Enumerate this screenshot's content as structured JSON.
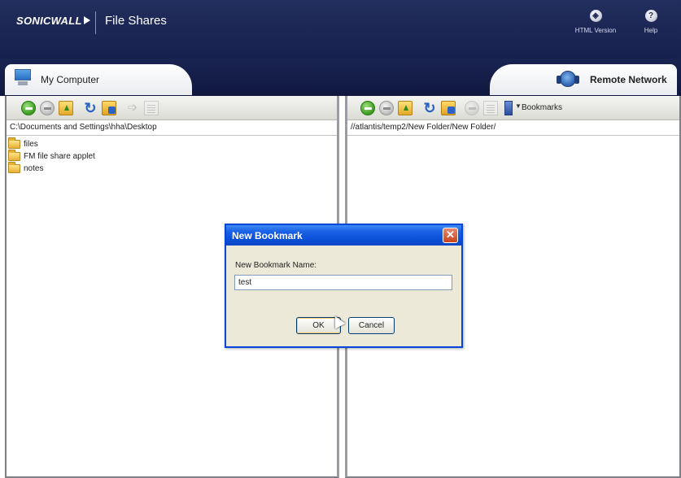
{
  "header": {
    "brand": "SONICWALL",
    "app_title": "File Shares",
    "html_version_label": "HTML Version",
    "help_label": "Help"
  },
  "tabs": {
    "left_label": "My Computer",
    "right_label": "Remote Network"
  },
  "left_panel": {
    "path": "C:\\Documents and Settings\\hha\\Desktop",
    "items": [
      "files",
      "FM file share applet",
      "notes"
    ]
  },
  "right_panel": {
    "path": "//atlantis/temp2/New Folder/New Folder/",
    "bookmarks_label": "Bookmarks"
  },
  "dialog": {
    "title": "New Bookmark",
    "name_label": "New Bookmark Name:",
    "name_value": "test",
    "ok_label": "OK",
    "cancel_label": "Cancel",
    "close_glyph": "✕"
  },
  "colors": {
    "header_bg": "#1c2755",
    "dialog_titlebar": "#0a4fd8",
    "dialog_bg": "#ece9d8"
  }
}
